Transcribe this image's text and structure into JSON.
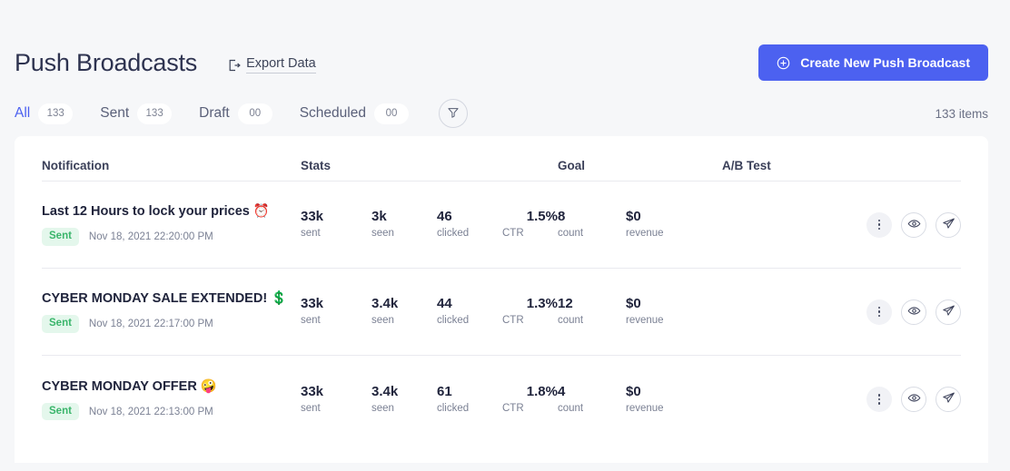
{
  "header": {
    "title": "Push Broadcasts",
    "export_label": "Export Data",
    "export_icon": "export-icon",
    "create_button_label": "Create New Push Broadcast",
    "create_button_icon": "plus-circle-icon",
    "accent_color": "#4c61f0"
  },
  "tabs": {
    "items": [
      {
        "label": "All",
        "count": "133",
        "active": true
      },
      {
        "label": "Sent",
        "count": "133",
        "active": false
      },
      {
        "label": "Draft",
        "count": "00",
        "active": false
      },
      {
        "label": "Scheduled",
        "count": "00",
        "active": false
      }
    ],
    "filter_icon": "filter-funnel-icon",
    "items_count": "133 items"
  },
  "table": {
    "columns": {
      "notification": "Notification",
      "stats": "Stats",
      "goal": "Goal",
      "abtest": "A/B Test"
    },
    "stat_labels": {
      "sent": "sent",
      "seen": "seen",
      "clicked": "clicked",
      "ctr": "CTR",
      "count": "count",
      "revenue": "revenue"
    },
    "rows": [
      {
        "title": "Last 12 Hours to lock your prices",
        "emoji": "⏰",
        "emoji_name": "alarm-clock-emoji",
        "status": "Sent",
        "status_color": "#3ab56b",
        "date": "Nov 18, 2021 22:20:00 PM",
        "sent": "33k",
        "seen": "3k",
        "clicked": "46",
        "ctr": "1.5%",
        "count": "8",
        "revenue": "$0",
        "abtest": ""
      },
      {
        "title": "CYBER MONDAY SALE EXTENDED!",
        "emoji": "💲",
        "emoji_name": "heavy-dollar-sign-emoji",
        "status": "Sent",
        "status_color": "#3ab56b",
        "date": "Nov 18, 2021 22:17:00 PM",
        "sent": "33k",
        "seen": "3.4k",
        "clicked": "44",
        "ctr": "1.3%",
        "count": "12",
        "revenue": "$0",
        "abtest": ""
      },
      {
        "title": "CYBER MONDAY OFFER",
        "emoji": "🤪",
        "emoji_name": "zany-face-emoji",
        "status": "Sent",
        "status_color": "#3ab56b",
        "date": "Nov 18, 2021 22:13:00 PM",
        "sent": "33k",
        "seen": "3.4k",
        "clicked": "61",
        "ctr": "1.8%",
        "count": "4",
        "revenue": "$0",
        "abtest": ""
      }
    ],
    "actions": {
      "menu_icon": "more-vertical-icon",
      "preview_icon": "eye-icon",
      "send_icon": "paper-plane-icon"
    }
  }
}
